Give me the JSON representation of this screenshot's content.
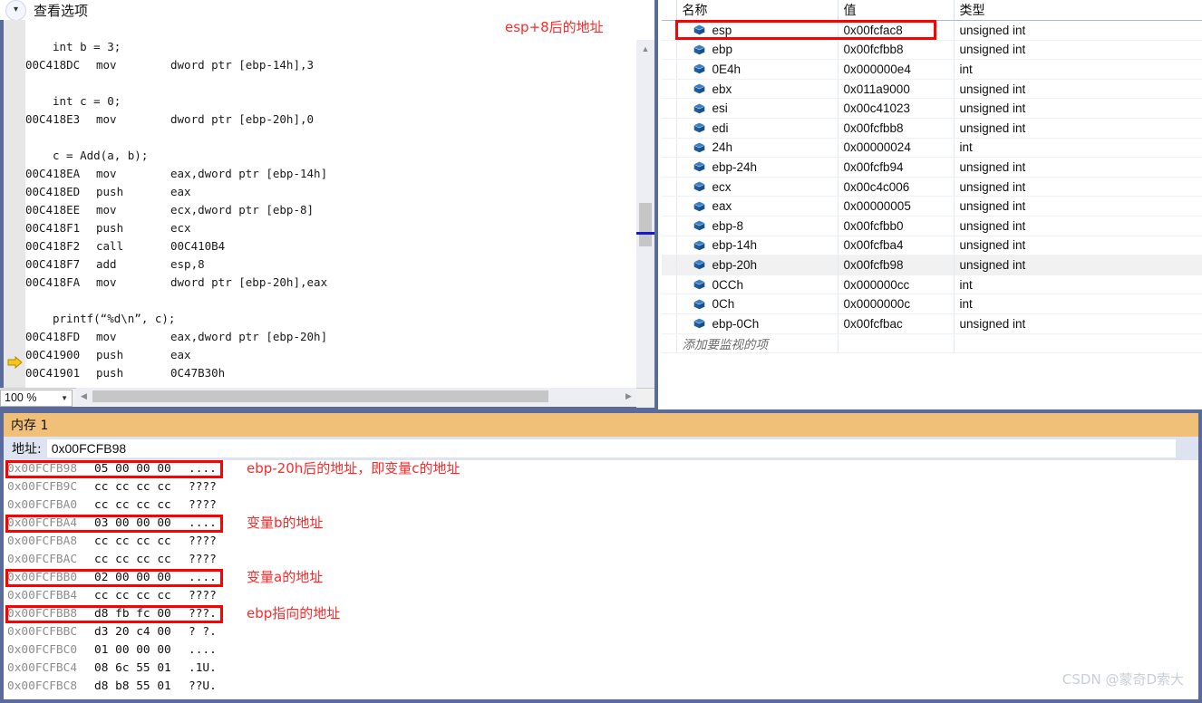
{
  "disassembly_window": {
    "header": {
      "label": "查看选项",
      "chevron_icon": "chevron-down-icon"
    },
    "lines": [
      {
        "type": "blank"
      },
      {
        "type": "source",
        "text": "    int b = 3;"
      },
      {
        "type": "asm",
        "address": "00C418DC",
        "mnemonic": "mov",
        "operands": "dword ptr [ebp-14h],3",
        "current": false
      },
      {
        "type": "blank"
      },
      {
        "type": "source",
        "text": "    int c = 0;"
      },
      {
        "type": "asm",
        "address": "00C418E3",
        "mnemonic": "mov",
        "operands": "dword ptr [ebp-20h],0",
        "current": false
      },
      {
        "type": "blank"
      },
      {
        "type": "source",
        "text": "    c = Add(a, b);"
      },
      {
        "type": "asm",
        "address": "00C418EA",
        "mnemonic": "mov",
        "operands": "eax,dword ptr [ebp-14h]",
        "current": false
      },
      {
        "type": "asm",
        "address": "00C418ED",
        "mnemonic": "push",
        "operands": "eax",
        "current": false
      },
      {
        "type": "asm",
        "address": "00C418EE",
        "mnemonic": "mov",
        "operands": "ecx,dword ptr [ebp-8]",
        "current": false
      },
      {
        "type": "asm",
        "address": "00C418F1",
        "mnemonic": "push",
        "operands": "ecx",
        "current": false
      },
      {
        "type": "asm",
        "address": "00C418F2",
        "mnemonic": "call",
        "operands": "00C410B4",
        "current": false
      },
      {
        "type": "asm",
        "address": "00C418F7",
        "mnemonic": "add",
        "operands": "esp,8",
        "current": false
      },
      {
        "type": "asm",
        "address": "00C418FA",
        "mnemonic": "mov",
        "operands": "dword ptr [ebp-20h],eax",
        "current": false
      },
      {
        "type": "blank"
      },
      {
        "type": "source",
        "text": "    printf(“%d\\n”, c);"
      },
      {
        "type": "asm",
        "address": "00C418FD",
        "mnemonic": "mov",
        "operands": "eax,dword ptr [ebp-20h]",
        "current": true
      },
      {
        "type": "asm",
        "address": "00C41900",
        "mnemonic": "push",
        "operands": "eax",
        "current": false
      },
      {
        "type": "asm",
        "address": "00C41901",
        "mnemonic": "push",
        "operands": "0C47B30h",
        "current": false
      }
    ],
    "annotation": "esp+8后的地址",
    "status_bar": {
      "zoom_value": "100 %",
      "zoom_arrow_icon": "chevron-down-icon"
    },
    "scrollbar": {
      "up_arrow_icon": "scroll-up-icon",
      "down_arrow_icon": "scroll-down-icon",
      "left_arrow_icon": "scroll-left-icon",
      "right_arrow_icon": "scroll-right-icon"
    }
  },
  "watch_window": {
    "columns": [
      "名称",
      "值",
      "类型"
    ],
    "rows": [
      {
        "name": "esp",
        "value": "0x00fcfac8",
        "type": "unsigned int",
        "selected": false,
        "highlighted": true
      },
      {
        "name": "ebp",
        "value": "0x00fcfbb8",
        "type": "unsigned int",
        "selected": false,
        "highlighted": false
      },
      {
        "name": "0E4h",
        "value": "0x000000e4",
        "type": "int",
        "selected": false,
        "highlighted": false
      },
      {
        "name": "ebx",
        "value": "0x011a9000",
        "type": "unsigned int",
        "selected": false,
        "highlighted": false
      },
      {
        "name": "esi",
        "value": "0x00c41023",
        "type": "unsigned int",
        "selected": false,
        "highlighted": false
      },
      {
        "name": "edi",
        "value": "0x00fcfbb8",
        "type": "unsigned int",
        "selected": false,
        "highlighted": false
      },
      {
        "name": "24h",
        "value": "0x00000024",
        "type": "int",
        "selected": false,
        "highlighted": false
      },
      {
        "name": "ebp-24h",
        "value": "0x00fcfb94",
        "type": "unsigned int",
        "selected": false,
        "highlighted": false
      },
      {
        "name": "ecx",
        "value": "0x00c4c006",
        "type": "unsigned int",
        "selected": false,
        "highlighted": false
      },
      {
        "name": "eax",
        "value": "0x00000005",
        "type": "unsigned int",
        "selected": false,
        "highlighted": false
      },
      {
        "name": "ebp-8",
        "value": "0x00fcfbb0",
        "type": "unsigned int",
        "selected": false,
        "highlighted": false
      },
      {
        "name": "ebp-14h",
        "value": "0x00fcfba4",
        "type": "unsigned int",
        "selected": false,
        "highlighted": false
      },
      {
        "name": "ebp-20h",
        "value": "0x00fcfb98",
        "type": "unsigned int",
        "selected": true,
        "highlighted": false
      },
      {
        "name": "0CCh",
        "value": "0x000000cc",
        "type": "int",
        "selected": false,
        "highlighted": false
      },
      {
        "name": "0Ch",
        "value": "0x0000000c",
        "type": "int",
        "selected": false,
        "highlighted": false
      },
      {
        "name": "ebp-0Ch",
        "value": "0x00fcfbac",
        "type": "unsigned int",
        "selected": false,
        "highlighted": false
      }
    ],
    "add_watch_placeholder": "添加要监视的项",
    "row_icon": "watch-cube-icon"
  },
  "memory_window": {
    "title": "内存 1",
    "address_label": "地址:",
    "address_value": "0x00FCFB98",
    "rows": [
      {
        "address": "0x00FCFB98",
        "hex": "05 00 00 00",
        "ascii": "....",
        "boxed": true
      },
      {
        "address": "0x00FCFB9C",
        "hex": "cc cc cc cc",
        "ascii": "????",
        "boxed": false
      },
      {
        "address": "0x00FCFBA0",
        "hex": "cc cc cc cc",
        "ascii": "????",
        "boxed": false
      },
      {
        "address": "0x00FCFBA4",
        "hex": "03 00 00 00",
        "ascii": "....",
        "boxed": true
      },
      {
        "address": "0x00FCFBA8",
        "hex": "cc cc cc cc",
        "ascii": "????",
        "boxed": false
      },
      {
        "address": "0x00FCFBAC",
        "hex": "cc cc cc cc",
        "ascii": "????",
        "boxed": false
      },
      {
        "address": "0x00FCFBB0",
        "hex": "02 00 00 00",
        "ascii": "....",
        "boxed": true
      },
      {
        "address": "0x00FCFBB4",
        "hex": "cc cc cc cc",
        "ascii": "????",
        "boxed": false
      },
      {
        "address": "0x00FCFBB8",
        "hex": "d8 fb fc 00",
        "ascii": "???.",
        "boxed": true
      },
      {
        "address": "0x00FCFBBC",
        "hex": "d3 20 c4 00",
        "ascii": "? ?.",
        "boxed": false
      },
      {
        "address": "0x00FCFBC0",
        "hex": "01 00 00 00",
        "ascii": "....",
        "boxed": false
      },
      {
        "address": "0x00FCFBC4",
        "hex": "08 6c 55 01",
        "ascii": ".1U.",
        "boxed": false
      },
      {
        "address": "0x00FCFBC8",
        "hex": "d8 b8 55 01",
        "ascii": "??U.",
        "boxed": false
      }
    ],
    "annotations": [
      {
        "text": "ebp-20h后的地址，即变量c的地址",
        "row": 0
      },
      {
        "text": "变量b的地址",
        "row": 3
      },
      {
        "text": "变量a的地址",
        "row": 6
      },
      {
        "text": "ebp指向的地址",
        "row": 8
      }
    ]
  },
  "watermark": "CSDN @蒙奇D索大",
  "colors": {
    "annotation_red": "#ff2a2a",
    "highlight_box_red": "#ff0000",
    "window_frame_blue": "#5a6a9a",
    "memory_title_orange": "#f0c078",
    "address_bar_blue": "#dde3f0",
    "current_line_arrow_yellow": "#f5c518"
  }
}
